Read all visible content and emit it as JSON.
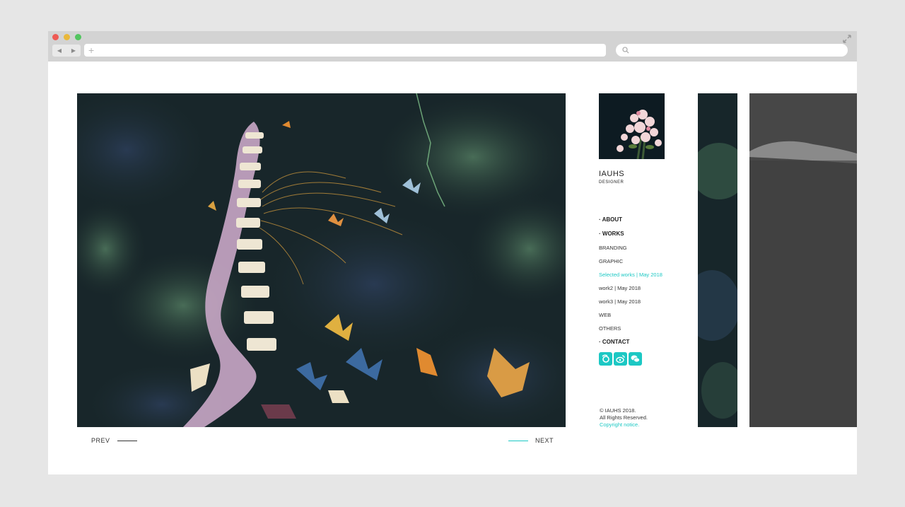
{
  "browser": {
    "back_glyph": "◀",
    "forward_glyph": "▶",
    "new_tab_glyph": "+",
    "icons": [
      "close-dot",
      "minimize-dot",
      "maximize-dot",
      "expand-icon",
      "search-icon"
    ]
  },
  "colors": {
    "accent": "#1cc8c4",
    "text": "#222222",
    "chrome": "#d3d3d3",
    "page_bg": "#e6e6e6"
  },
  "pager": {
    "prev": "PREV",
    "next": "NEXT"
  },
  "profile": {
    "name": "IAUHS",
    "role": "DESIGNER"
  },
  "menu": {
    "about": "· ABOUT",
    "works": "· WORKS",
    "items": [
      {
        "label": "BRANDING"
      },
      {
        "label": "GRAPHIC"
      },
      {
        "label": "Selected works | May 2018"
      },
      {
        "label": "work2 | May 2018"
      },
      {
        "label": "work3 | May 2018"
      },
      {
        "label": "WEB"
      },
      {
        "label": "OTHERS"
      }
    ],
    "active_index": 2,
    "contact": "· CONTACT"
  },
  "social_icons": [
    "douban-icon",
    "weibo-icon",
    "wechat-icon"
  ],
  "footer": {
    "line1": "© IAUHS 2018.",
    "line2": "All Rights Reserved.",
    "notice": "Copyright notice."
  }
}
